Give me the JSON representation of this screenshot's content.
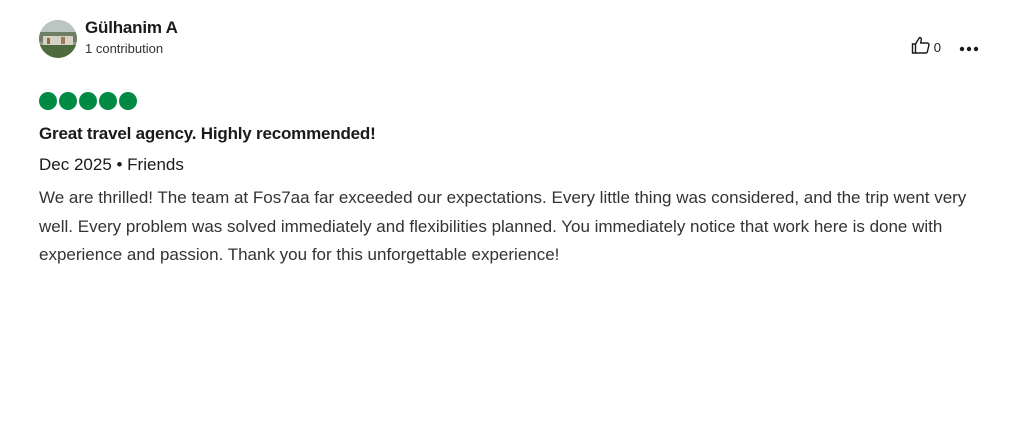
{
  "review": {
    "user": {
      "name": "Gülhanim A",
      "contributions": "1 contribution",
      "avatar_icon": "avatar-photo"
    },
    "actions": {
      "like_icon": "thumbs-up-icon",
      "like_count": "0",
      "more_icon": "more-horizontal-icon"
    },
    "rating": {
      "value": 5,
      "max": 5,
      "color": "#008a43"
    },
    "title": "Great travel agency. Highly recommended!",
    "date_and_type": "Dec 2025 • Friends",
    "text": "We are thrilled! The team at Fos7aa far exceeded our expectations. Every little thing was considered, and the trip went very well. Every problem was solved immediately and flexibilities planned. You immediately notice that work here is done with experience and passion. Thank you for this unforgettable experience!"
  }
}
